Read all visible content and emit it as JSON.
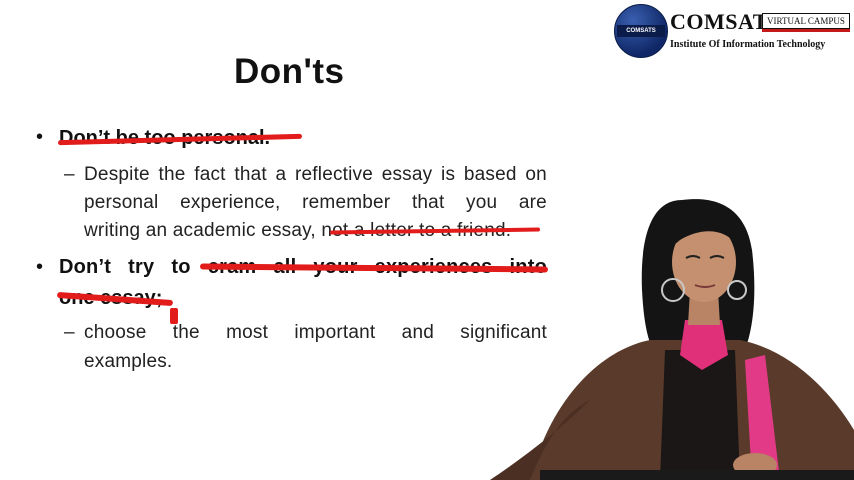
{
  "logo": {
    "seal_text": "COMSATS",
    "name": "COMSATS",
    "virtual_campus": "VIRTUAL CAMPUS",
    "subtitle": "Institute Of Information Technology"
  },
  "slide": {
    "title": "Don'ts",
    "bullet1": "Don’t be too personal.",
    "sub1_line1": [
      "Despite",
      "the",
      "fact",
      "that",
      "a",
      "reflective",
      "essay",
      "is",
      "based",
      "on"
    ],
    "sub1_line2": [
      "personal",
      "experience,",
      "remember",
      "that",
      "you",
      "are"
    ],
    "sub1_line3a": "writing an academic essay, ",
    "sub1_line3b": "not a letter to a friend.",
    "bullet2_line1": [
      "Don’t",
      "try",
      "to",
      "cram",
      "all",
      "your",
      "experiences",
      "into"
    ],
    "bullet2_line2": "one essay;",
    "sub2_line1": [
      "choose",
      "the",
      "most",
      "important",
      "and",
      "significant"
    ],
    "sub2_line2": "examples."
  },
  "colors": {
    "annotation_red": "#e21b1b",
    "logo_blue": "#0f2766",
    "logo_red": "#c41919"
  }
}
